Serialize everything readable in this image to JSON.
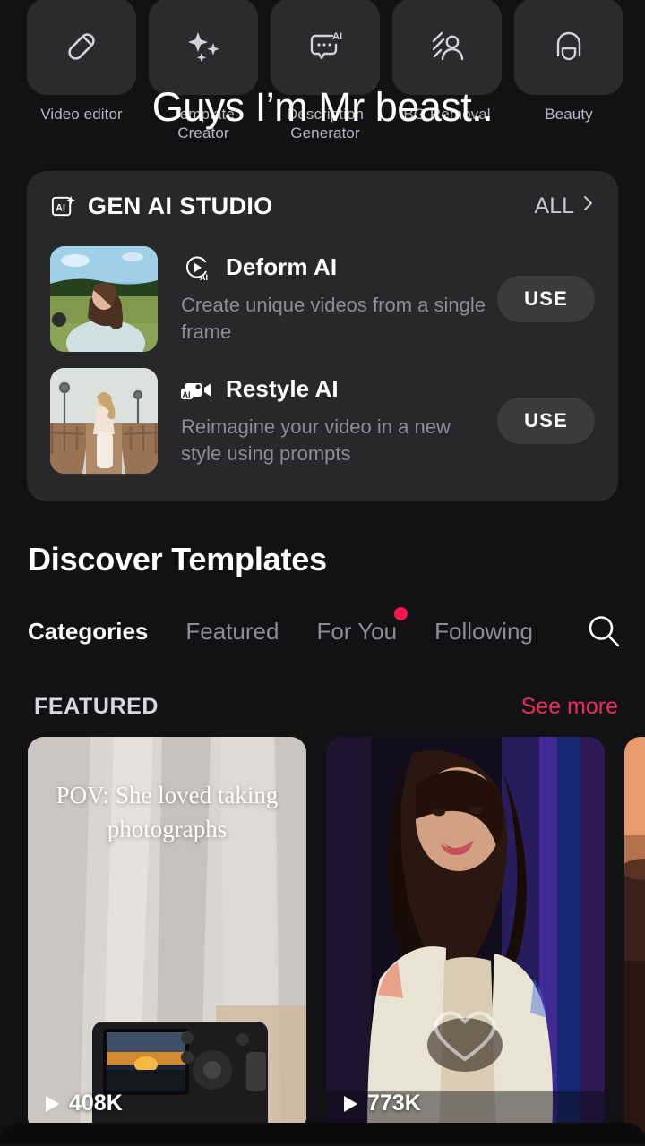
{
  "caption_overlay": "Guys I’m Mr beast..",
  "tools": [
    {
      "label": "Video editor",
      "icon": "pencil-icon"
    },
    {
      "label": "Template Creator",
      "icon": "sparkles-icon"
    },
    {
      "label": "Description Generator",
      "icon": "chat-ai-icon"
    },
    {
      "label": "BG Removal",
      "icon": "person-bg-removal-icon"
    },
    {
      "label": "Beauty",
      "icon": "face-beauty-icon"
    }
  ],
  "gen_ai_studio": {
    "title": "GEN AI STUDIO",
    "badge_icon": "ai-badge-icon",
    "all_label": "ALL",
    "chevron_icon": "chevron-right-icon",
    "items": [
      {
        "name": "Deform AI",
        "description": "Create unique videos from a single frame",
        "button_label": "USE",
        "icon": "play-ai-icon",
        "thumb_alt": "woman-in-green-field"
      },
      {
        "name": "Restyle AI",
        "description": "Reimagine your video in a new style using prompts",
        "button_label": "USE",
        "icon": "video-ai-icon",
        "thumb_alt": "woman-on-pier"
      }
    ]
  },
  "discover": {
    "title": "Discover Templates",
    "tabs": [
      {
        "label": "Categories",
        "active": true,
        "dot": false
      },
      {
        "label": "Featured",
        "active": false,
        "dot": false
      },
      {
        "label": "For You",
        "active": false,
        "dot": true
      },
      {
        "label": "Following",
        "active": false,
        "dot": false
      }
    ],
    "search_icon": "search-icon"
  },
  "featured": {
    "section_label": "FEATURED",
    "see_more_label": "See more",
    "cards": [
      {
        "overlay_text": "POV: She loved taking photographs",
        "plays": "408K",
        "media_alt": "camera-on-white-fabric-with-sunset-photo"
      },
      {
        "overlay_text": "",
        "plays": "773K",
        "media_alt": "woman-with-dark-wavy-hair-blue-stage-lights"
      },
      {
        "overlay_text": "",
        "plays": "",
        "media_alt": "orange-sunset-sky-partial"
      }
    ]
  },
  "colors": {
    "page_bg": "#121214",
    "panel_bg": "#28282a",
    "tile_bg": "#2b2b2d",
    "accent_pink": "#ef2a5c",
    "dot_pink": "#f2184f",
    "use_button_bg": "#3b3b3e",
    "muted_text": "#8d8d92"
  }
}
